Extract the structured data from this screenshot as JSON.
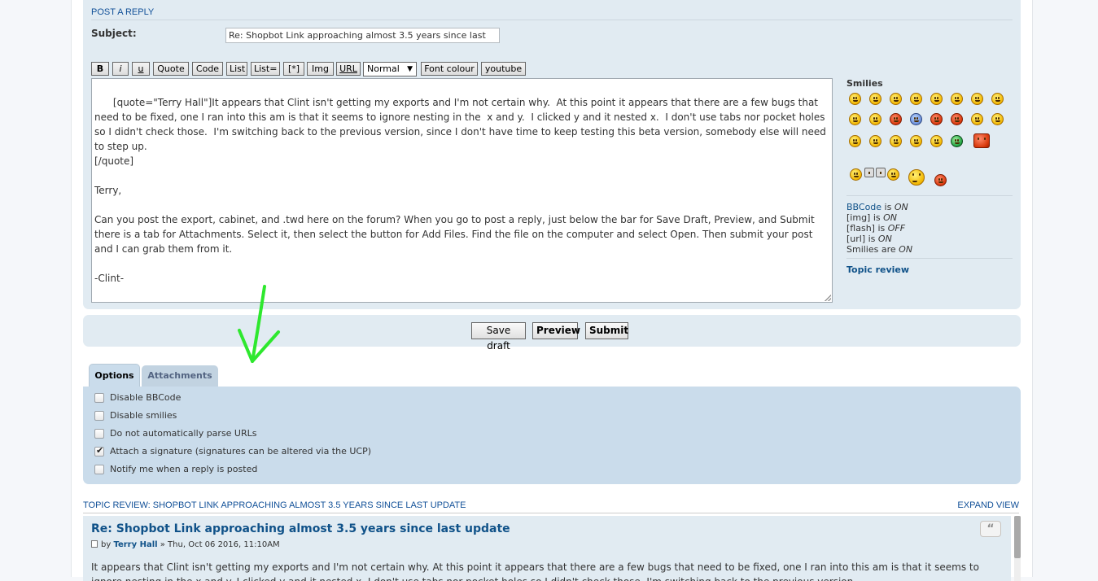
{
  "posting": {
    "title": "POST A REPLY",
    "subject_label": "Subject:",
    "subject_value": "Re: Shopbot Link approaching almost 3.5 years since last"
  },
  "toolbar": {
    "bold": "B",
    "italic": "i",
    "underline": "u",
    "quote": "Quote",
    "code": "Code",
    "list": "List",
    "list_ordered": "List=",
    "list_item": "[*]",
    "img": "Img",
    "url": "URL",
    "font_size": "Normal",
    "font_colour": "Font colour",
    "youtube": "youtube"
  },
  "editor": {
    "content": "[quote=\"Terry Hall\"]It appears that Clint isn't getting my exports and I'm not certain why.  At this point it appears that there are a few bugs that need to be fixed, one I ran into this am is that it seems to ignore nesting in the  x and y.  I clicked y and it nested x.  I don't use tabs nor pocket holes so I didn't check those.  I'm switching back to the previous version, since I don't have time to keep testing this beta version, somebody else will need to step up.\n[/quote]\n\nTerry,\n\nCan you post the export, cabinet, and .twd here on the forum? When you go to post a reply, just below the bar for Save Draft, Preview, and Submit there is a tab for Attachments. Select it, then select the button for Add Files. Find the file on the computer and select Open. Then submit your post and I can grab them from it.\n\n-Clint-"
  },
  "sidebar": {
    "smilies_title": "Smilies",
    "bbcode_label": "BBCode",
    "bbcode_is": " is ",
    "bbcode_state": "ON",
    "img_label": "[img] is ",
    "img_state": "ON",
    "flash_label": "[flash] is ",
    "flash_state": "OFF",
    "url_label": "[url] is ",
    "url_state": "ON",
    "smilies_label": "Smilies are ",
    "smilies_state": "ON",
    "topic_review": "Topic review"
  },
  "actions": {
    "save_draft": "Save draft",
    "preview": "Preview",
    "submit": "Submit"
  },
  "tabs": {
    "options": "Options",
    "attachments": "Attachments"
  },
  "options": [
    {
      "label": "Disable BBCode",
      "checked": false
    },
    {
      "label": "Disable smilies",
      "checked": false
    },
    {
      "label": "Do not automatically parse URLs",
      "checked": false
    },
    {
      "label": "Attach a signature (signatures can be altered via the UCP)",
      "checked": true
    },
    {
      "label": "Notify me when a reply is posted",
      "checked": false
    }
  ],
  "review": {
    "title": "TOPIC REVIEW: SHOPBOT LINK APPROACHING ALMOST 3.5 YEARS SINCE LAST UPDATE",
    "expand": "EXPAND VIEW",
    "post_title": "Re: Shopbot Link approaching almost 3.5 years since last update",
    "by": "by ",
    "author": "Terry Hall",
    "date": " » Thu, Oct 06 2016, 11:10AM",
    "quote_glyph": "“",
    "body": "It appears that Clint isn't getting my exports and I'm not certain why. At this point it appears that there are a few bugs that need to be fixed, one I ran into this am is that it seems to ignore nesting in the x and y. I clicked y and it nested x. I don't use tabs nor pocket holes so I didn't check those. I'm switching back to the previous version."
  },
  "colors": {
    "accent": "#115098",
    "panel_bg": "#e1ebf2",
    "options_bg": "#cadceb",
    "annotation_arrow": "#2ee82e"
  }
}
